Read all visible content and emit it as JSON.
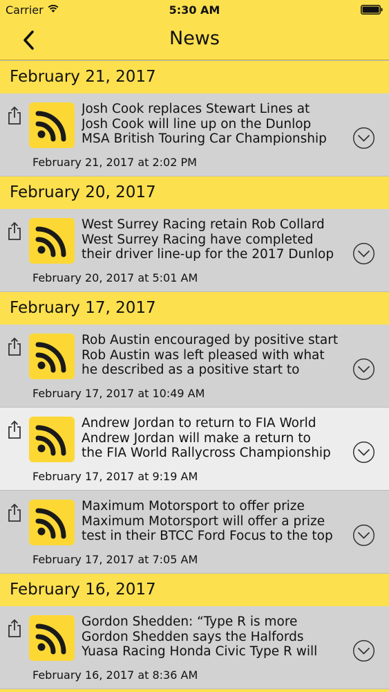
{
  "status_bar": {
    "carrier": "Carrier",
    "time": "5:30 AM"
  },
  "nav": {
    "title": "News",
    "back_icon": "chevron-left-icon"
  },
  "colors": {
    "accent": "#fde04e",
    "thumb": "#fdd835",
    "row_bg": "#d2d2d2",
    "row_selected_bg": "#ededed"
  },
  "sections": [
    {
      "date": "February 21, 2017",
      "items": [
        {
          "line1": "Josh Cook replaces Stewart Lines at",
          "line2": "Josh Cook will line up on the Dunlop",
          "line3": "MSA British Touring Car Championship",
          "timestamp": "February 21, 2017 at 2:02 PM"
        }
      ]
    },
    {
      "date": "February 20, 2017",
      "items": [
        {
          "line1": "West Surrey Racing retain Rob Collard",
          "line2": "West Surrey Racing have completed",
          "line3": "their driver line-up for the 2017 Dunlop",
          "timestamp": "February 20, 2017 at 5:01 AM"
        }
      ]
    },
    {
      "date": "February 17, 2017",
      "items": [
        {
          "line1": "Rob Austin encouraged by positive start",
          "line2": "Rob Austin was left pleased with what",
          "line3": "he described as a positive start to",
          "timestamp": "February 17, 2017 at 10:49 AM"
        },
        {
          "line1": "Andrew Jordan to return to FIA World",
          "line2": "Andrew Jordan will make a return to",
          "line3": "the FIA World Rallycross Championship",
          "timestamp": "February 17, 2017 at 9:19 AM"
        },
        {
          "line1": "Maximum Motorsport to offer prize",
          "line2": "Maximum Motorsport will offer a prize",
          "line3": "test in their BTCC Ford Focus to the top",
          "timestamp": "February 17, 2017 at 7:05 AM"
        }
      ]
    },
    {
      "date": "February 16, 2017",
      "items": [
        {
          "line1": "Gordon Shedden: “Type R is more",
          "line2": "Gordon Shedden says the Halfords",
          "line3": "Yuasa Racing Honda Civic Type R will",
          "timestamp": "February 16, 2017 at 8:36 AM"
        }
      ]
    }
  ]
}
